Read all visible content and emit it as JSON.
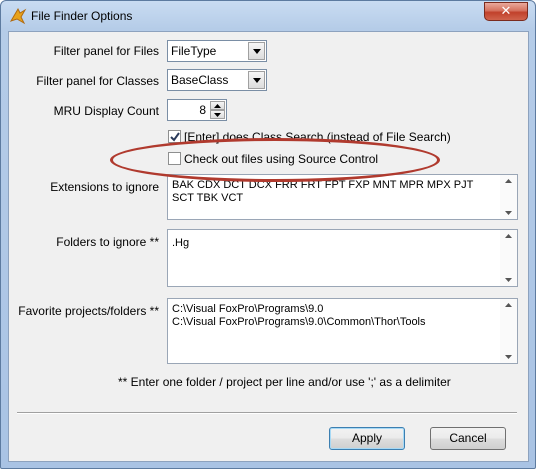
{
  "window": {
    "title": "File Finder Options",
    "close_label": "✕"
  },
  "fields": {
    "filter_files_label": "Filter panel for Files",
    "filter_files_value": "FileType",
    "filter_classes_label": "Filter panel for Classes",
    "filter_classes_value": "BaseClass",
    "mru_label": "MRU Display Count",
    "mru_value": "8",
    "enter_class_search_label": "[Enter] does Class Search (instead of File Search)",
    "enter_class_search_checked": true,
    "source_control_label": "Check out files using Source Control",
    "source_control_checked": false,
    "extensions_label": "Extensions to ignore",
    "extensions_value": "BAK CDX DCT DCX FRR FRT FPT FXP MNT MPR MPX PJT SCT TBK VCT",
    "folders_label": "Folders to ignore **",
    "folders_value": ".Hg",
    "favorites_label": "Favorite projects/folders **",
    "favorites_value": "C:\\Visual FoxPro\\Programs\\9.0\nC:\\Visual FoxPro\\Programs\\9.0\\Common\\Thor\\Tools"
  },
  "note": "** Enter one folder / project per line and/or use ';' as a delimiter",
  "buttons": {
    "apply": "Apply",
    "cancel": "Cancel"
  },
  "colors": {
    "annotation_ellipse": "#b03a2e"
  }
}
